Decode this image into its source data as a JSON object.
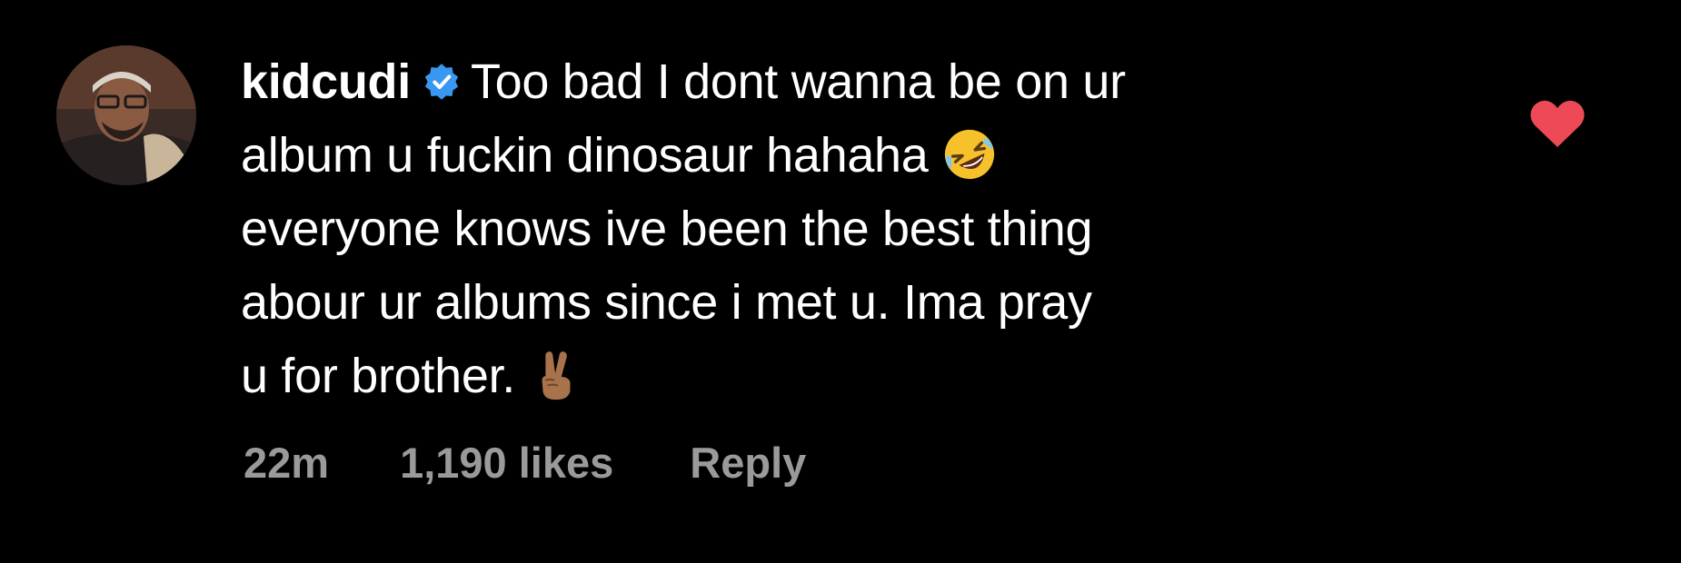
{
  "comment": {
    "username": "kidcudi",
    "verified": true,
    "lines": [
      "Too bad I dont wanna be on ur",
      "album u fuckin dinosaur hahaha",
      "everyone knows ive been the best thing",
      "abour ur albums since i met u.  Ima pray",
      "u for brother."
    ],
    "emojis": {
      "line2": "rolling-on-floor-laughing-emoji",
      "line5": "victory-hand-emoji"
    },
    "timestamp": "22m",
    "likes": "1,190 likes",
    "reply_label": "Reply",
    "liked": true
  },
  "colors": {
    "background": "#000000",
    "text": "#ffffff",
    "meta_text": "#9a9a9a",
    "verified_badge": "#3897f0",
    "heart": "#ed4956"
  }
}
